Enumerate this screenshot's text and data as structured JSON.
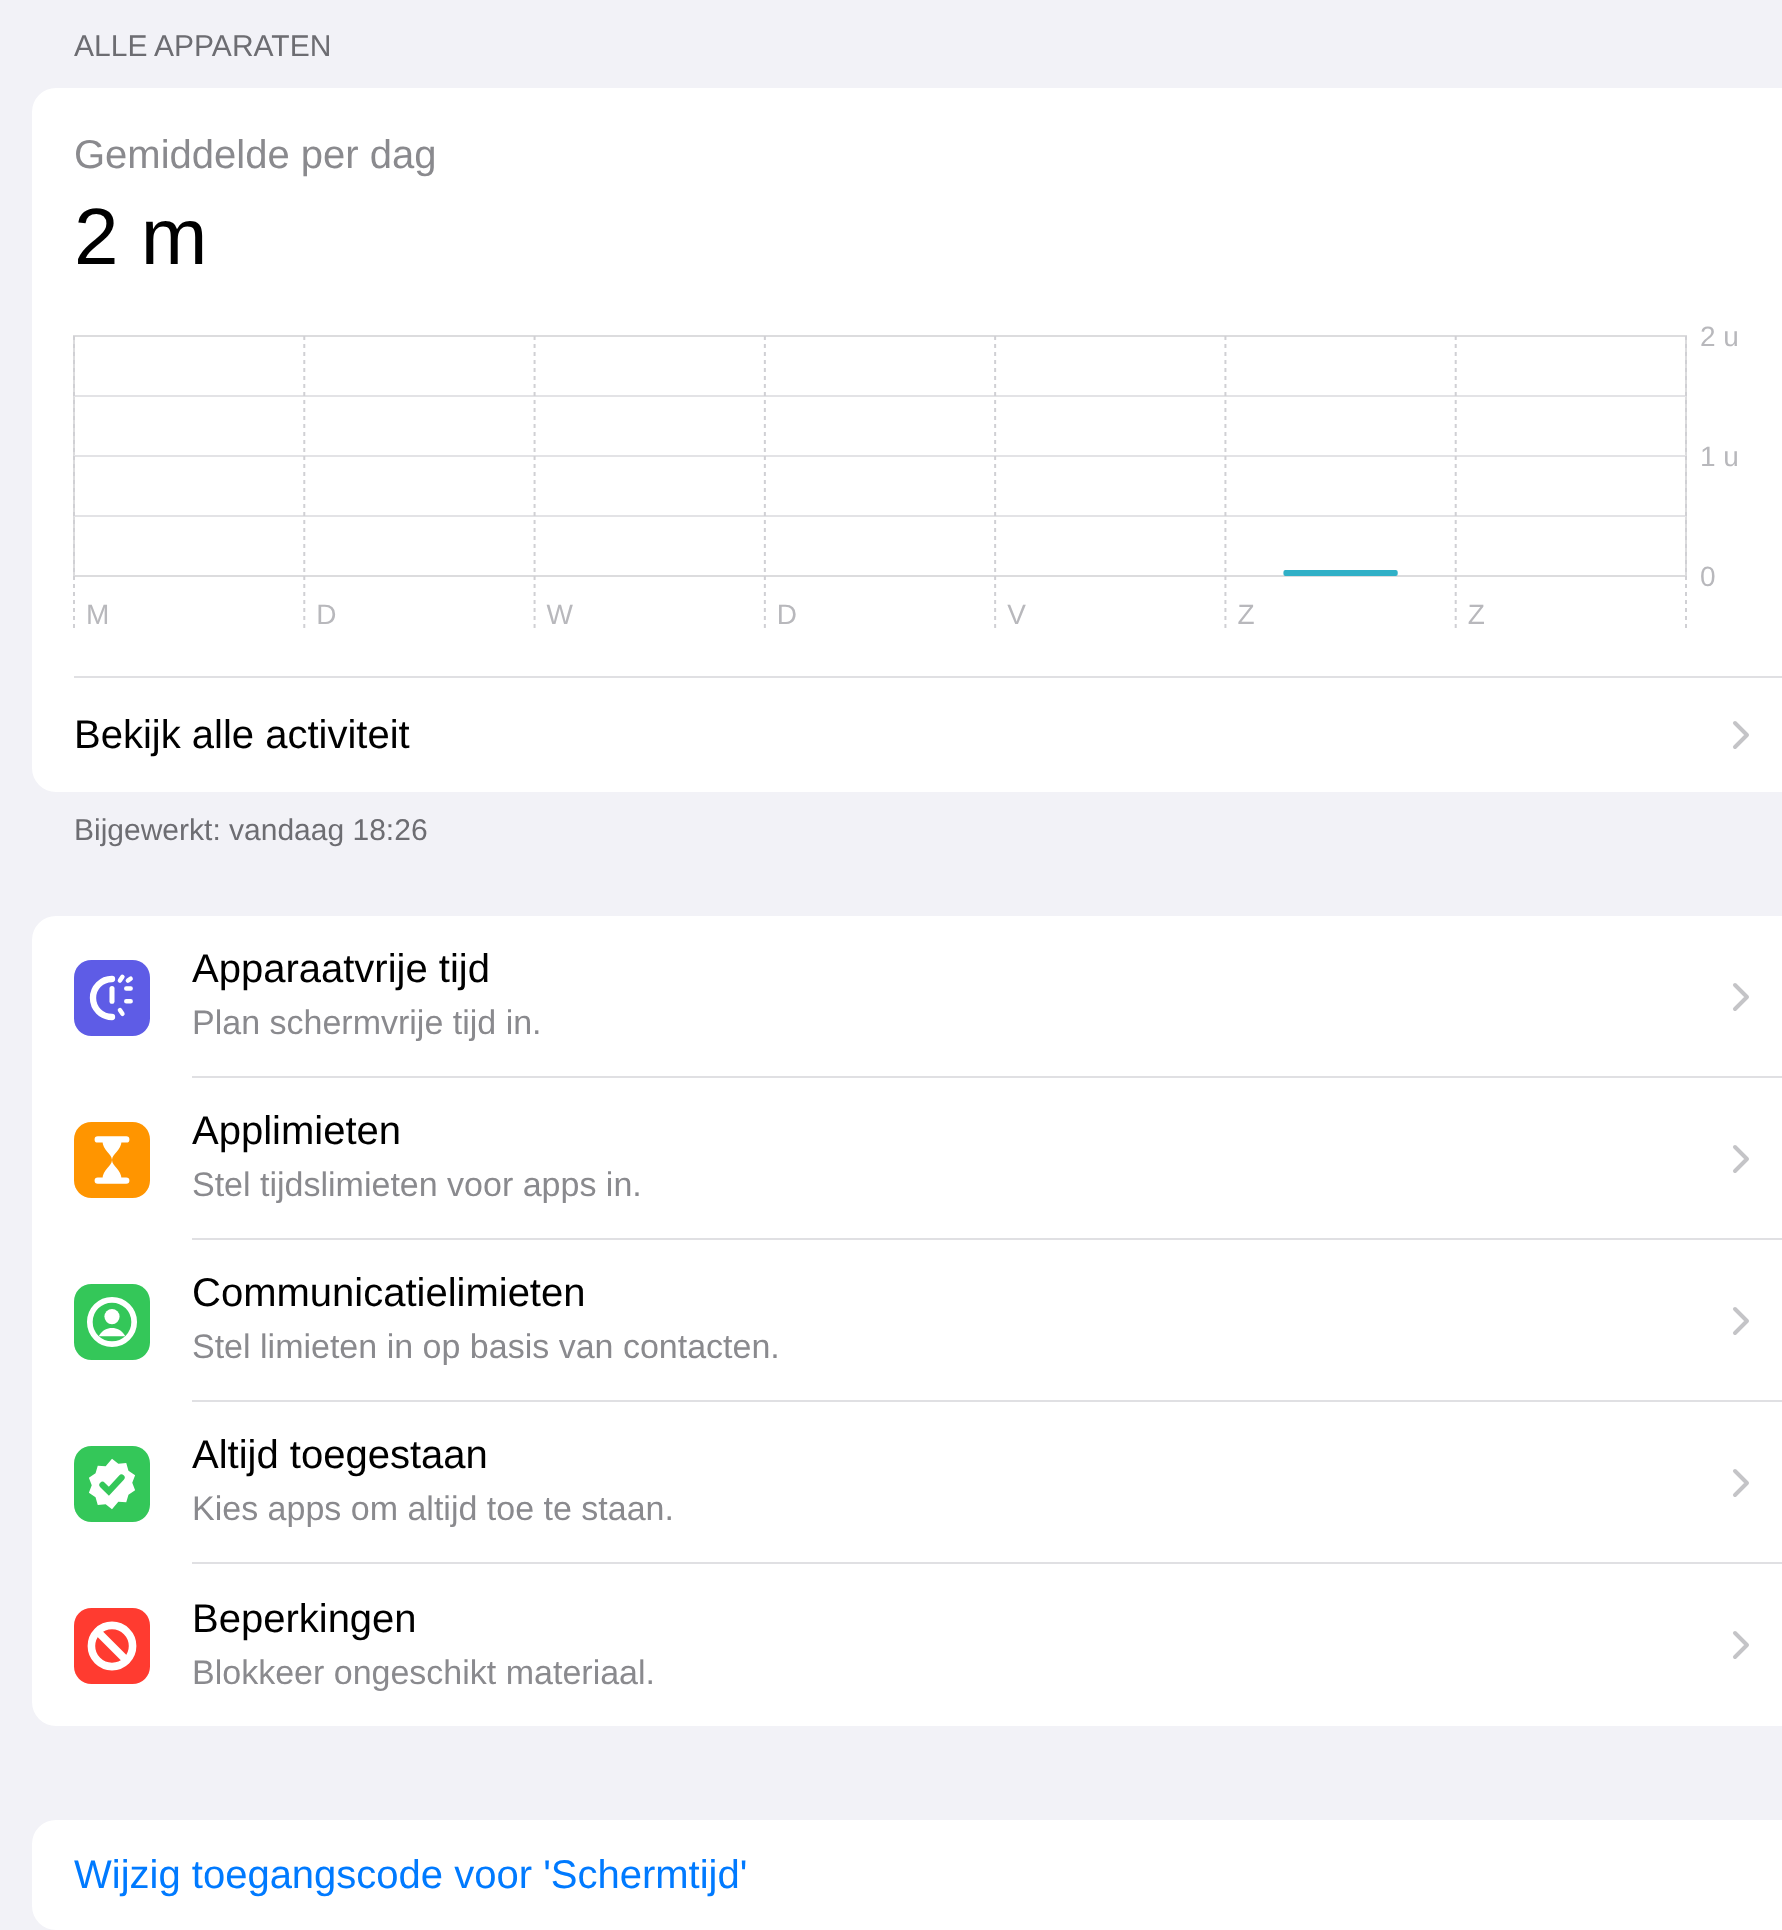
{
  "section_header": "ALLE APPARATEN",
  "summary": {
    "label": "Gemiddelde per dag",
    "value": "2 m",
    "chart_data": {
      "type": "bar",
      "categories": [
        "M",
        "D",
        "W",
        "D",
        "V",
        "Z",
        "Z"
      ],
      "values": [
        0,
        0,
        0,
        0,
        0,
        0.05,
        0
      ],
      "ylim": [
        0,
        2
      ],
      "yticks": [
        {
          "value": 0,
          "label": "0"
        },
        {
          "value": 1,
          "label": "1 u"
        },
        {
          "value": 2,
          "label": "2 u"
        }
      ]
    },
    "link": "Bekijk alle activiteit"
  },
  "updated": "Bijgewerkt: vandaag 18:26",
  "settings": [
    {
      "kind": "downtime",
      "title": "Apparaatvrije tijd",
      "subtitle": "Plan schermvrije tijd in.",
      "color": "#5e5ce6"
    },
    {
      "kind": "limits",
      "title": "Applimieten",
      "subtitle": "Stel tijdslimieten voor apps in.",
      "color": "#ff9500"
    },
    {
      "kind": "communication",
      "title": "Communicatielimieten",
      "subtitle": "Stel limieten in op basis van contacten.",
      "color": "#34c759"
    },
    {
      "kind": "allowed",
      "title": "Altijd toegestaan",
      "subtitle": "Kies apps om altijd toe te staan.",
      "color": "#34c759"
    },
    {
      "kind": "restrictions",
      "title": "Beperkingen",
      "subtitle": "Blokkeer ongeschikt materiaal.",
      "color": "#ff3b30"
    }
  ],
  "passcode_link": "Wijzig toegangscode voor 'Schermtijd'"
}
